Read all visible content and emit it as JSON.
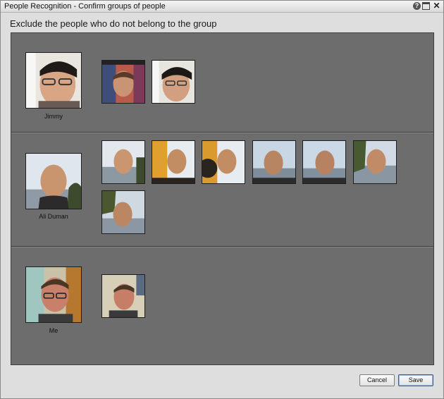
{
  "window": {
    "title": "People Recognition - Confirm groups of people",
    "controls": [
      "help-icon",
      "maximize-icon",
      "close-icon"
    ],
    "help_glyph": "?",
    "close_glyph": "✕"
  },
  "instruction": "Exclude the people who do not belong to the group",
  "groups": [
    {
      "name": "Jimmy",
      "candidate_count": 2
    },
    {
      "name": "Ali Duman",
      "candidate_count": 7
    },
    {
      "name": "Me",
      "candidate_count": 1
    }
  ],
  "buttons": {
    "cancel": "Cancel",
    "save": "Save"
  },
  "colors": {
    "panel": "#6d6d6d",
    "window": "#dedede",
    "primary_button_border": "#3b5d8a"
  }
}
